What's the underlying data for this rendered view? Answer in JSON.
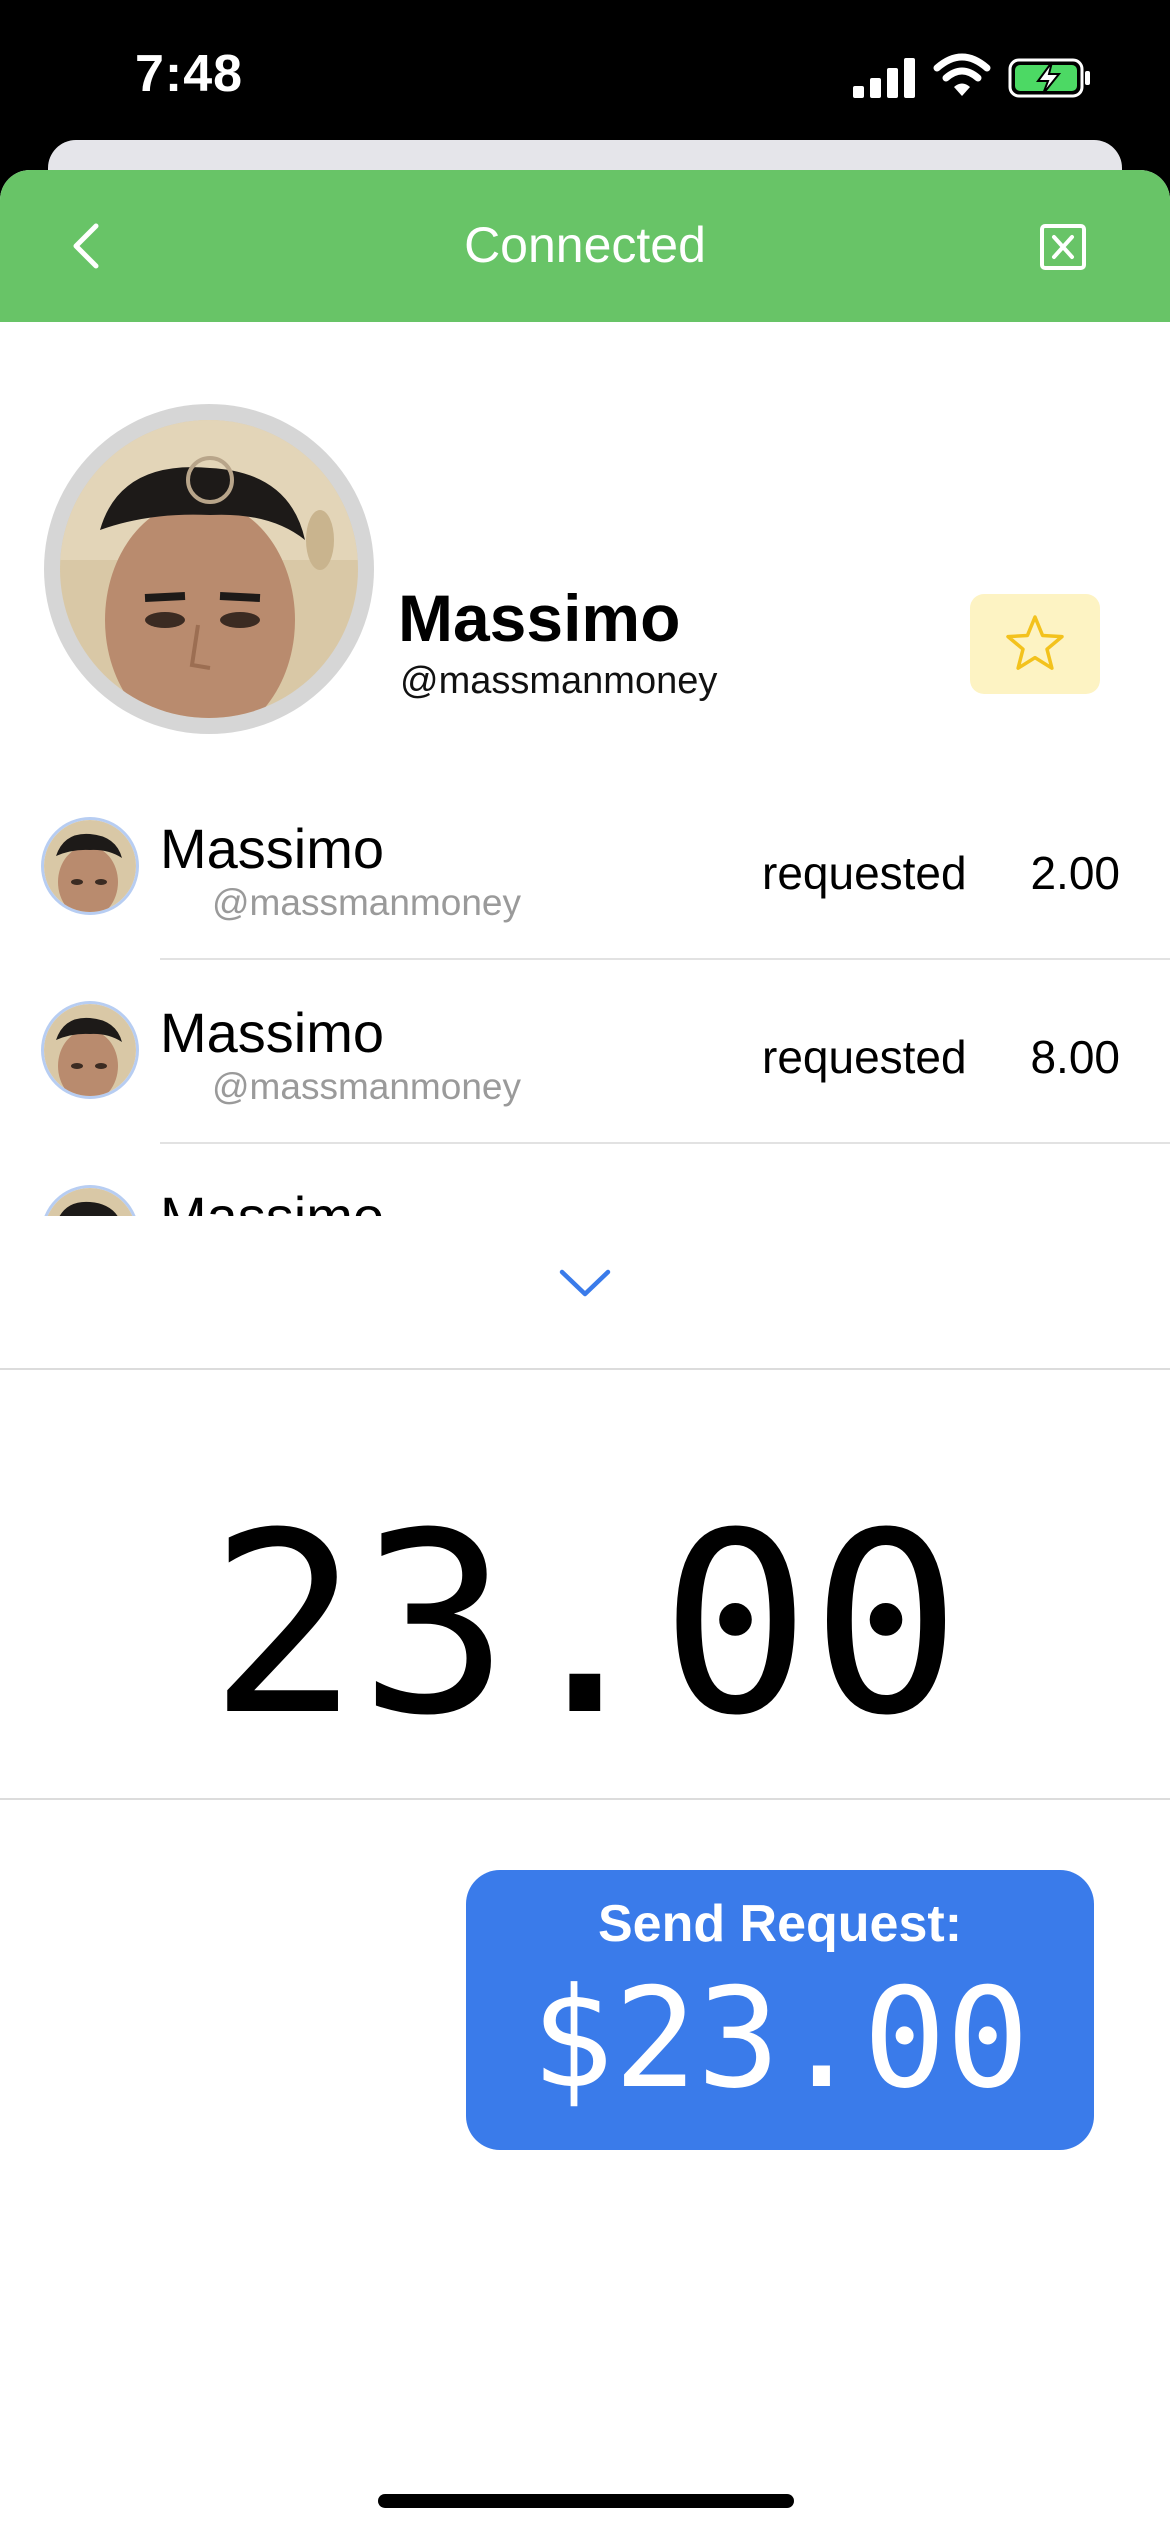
{
  "status_bar": {
    "time": "7:48"
  },
  "header": {
    "title": "Connected"
  },
  "profile": {
    "name": "Massimo",
    "handle": "@massmanmoney"
  },
  "transactions": [
    {
      "name": "Massimo",
      "handle": "@massmanmoney",
      "status": "requested",
      "amount": "2.00"
    },
    {
      "name": "Massimo",
      "handle": "@massmanmoney",
      "status": "requested",
      "amount": "8.00"
    },
    {
      "name": "Massimo",
      "handle": "",
      "status": "",
      "amount": ""
    }
  ],
  "amount": {
    "value": "23.00"
  },
  "send_button": {
    "label": "Send Request:",
    "amount": "$23.00"
  },
  "colors": {
    "header": "#68c467",
    "accent": "#3a7bea",
    "favorite_bg": "#fdf3c3",
    "star": "#f3c21d"
  },
  "icons": [
    "signal-icon",
    "wifi-icon",
    "battery-charging-icon",
    "back-chevron-icon",
    "close-box-icon",
    "star-icon",
    "chevron-down-icon"
  ]
}
